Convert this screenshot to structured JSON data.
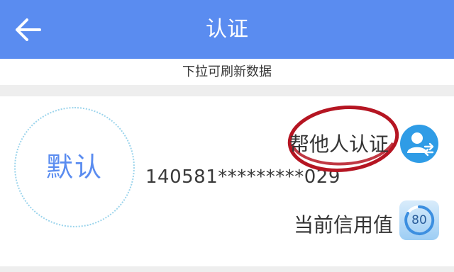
{
  "header": {
    "title": "认证",
    "back_icon": "arrow-left-icon"
  },
  "refresh_hint": "下拉可刷新数据",
  "card": {
    "default_label": "默认",
    "id_number": "140581*********029",
    "help_auth": {
      "label": "帮他人认证",
      "icon": "user-switch-icon"
    },
    "credit": {
      "label": "当前信用值",
      "score": "80",
      "icon": "credit-score-icon"
    }
  },
  "colors": {
    "header": "#5a8cf0",
    "accent": "#5a8cf0",
    "icon_blue": "#2f9ce6",
    "annotation": "#b51522"
  }
}
